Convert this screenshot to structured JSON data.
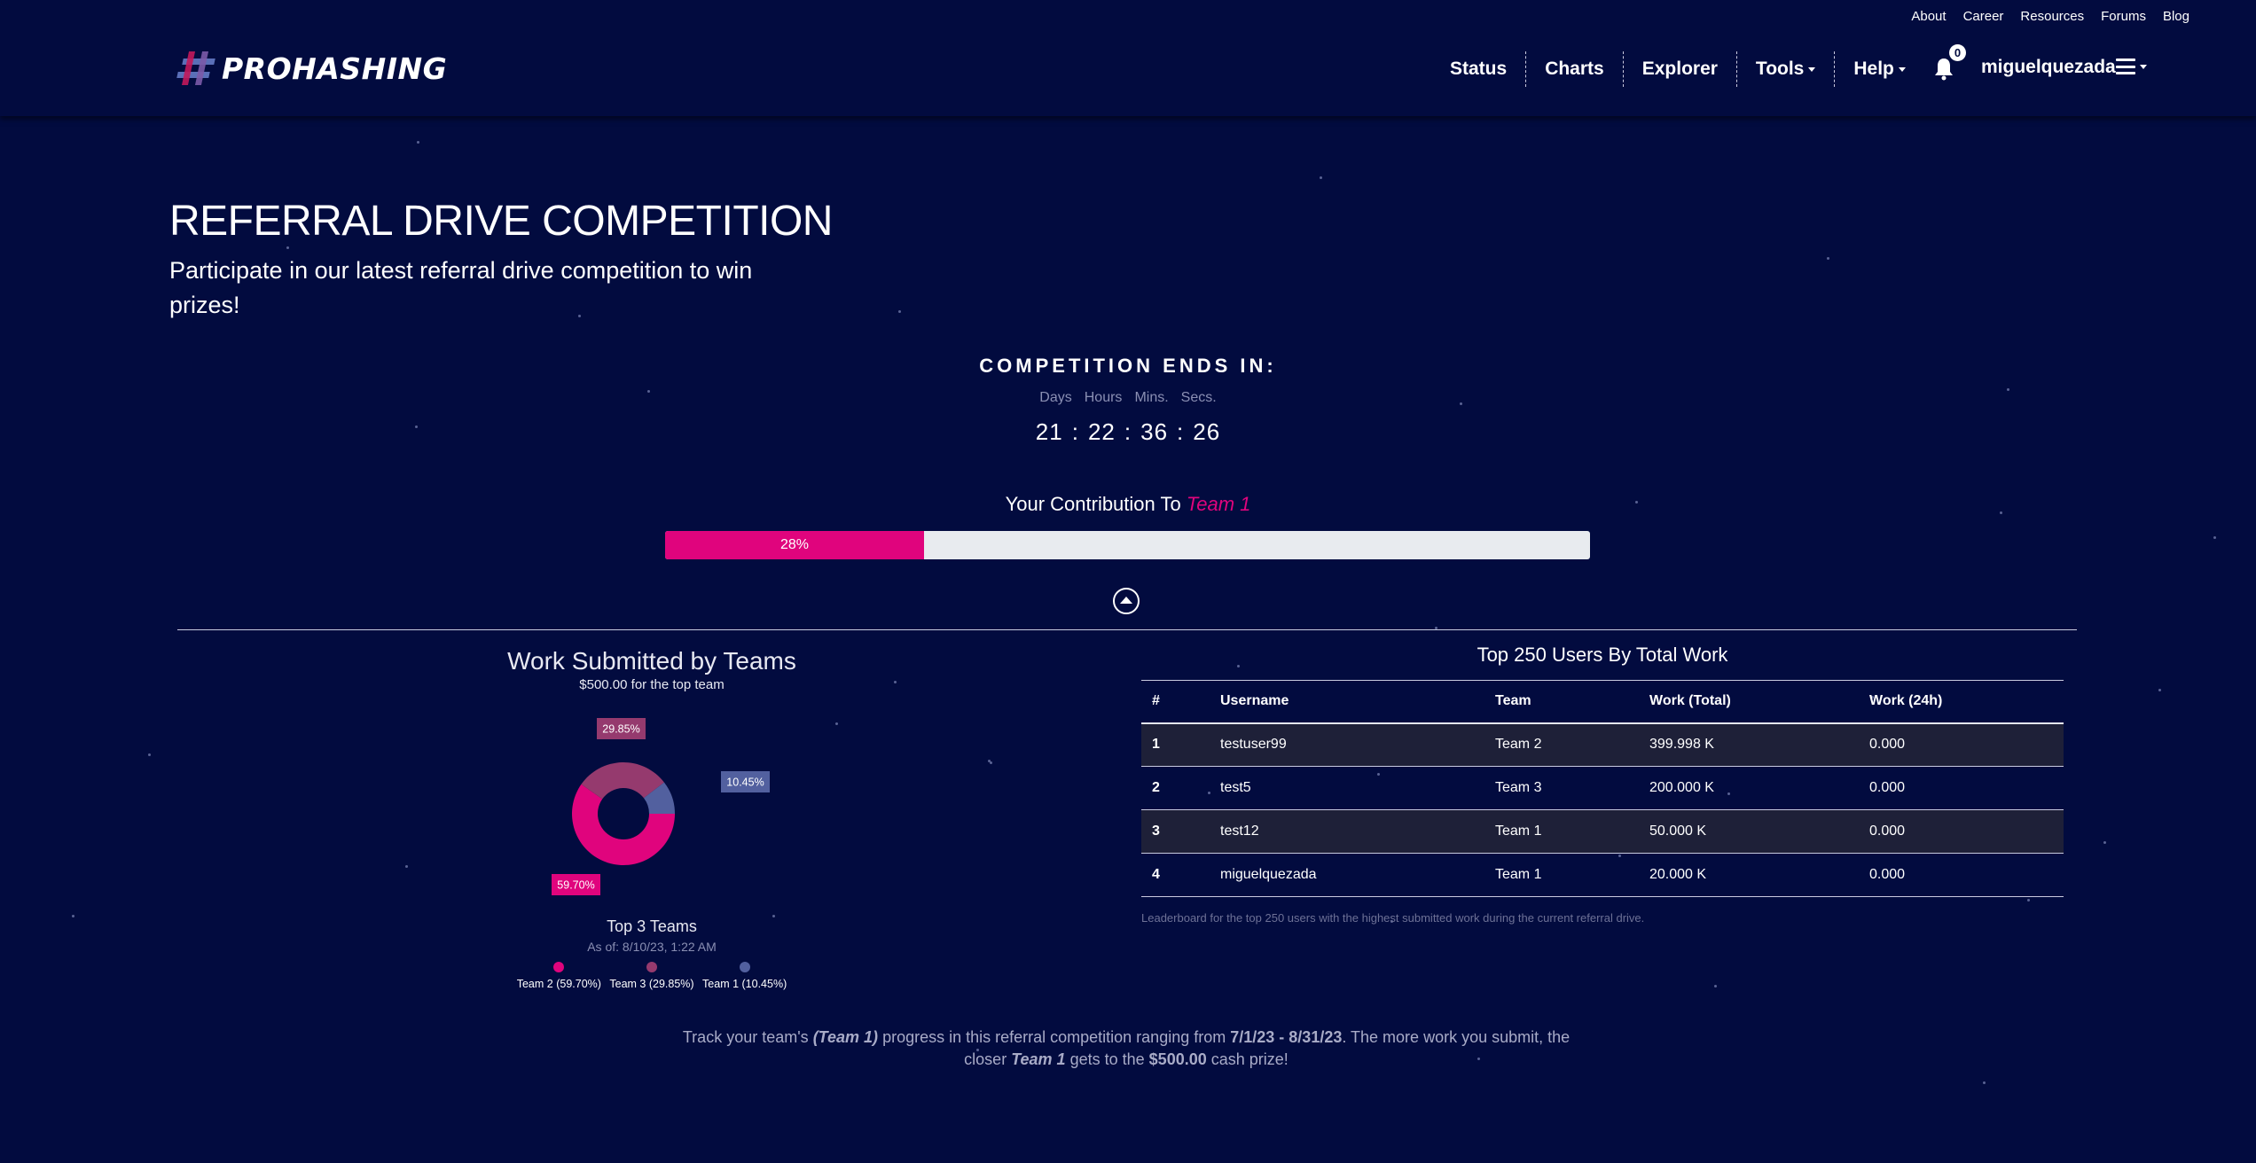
{
  "brand": {
    "name": "PROHASHING",
    "logo_icon": "hash-logo-icon"
  },
  "top_links": [
    "About",
    "Career",
    "Resources",
    "Forums",
    "Blog"
  ],
  "nav": {
    "items": [
      {
        "label": "Status",
        "dropdown": false
      },
      {
        "label": "Charts",
        "dropdown": false
      },
      {
        "label": "Explorer",
        "dropdown": false
      },
      {
        "label": "Tools",
        "dropdown": true
      },
      {
        "label": "Help",
        "dropdown": true
      }
    ],
    "notifications_count": "0",
    "username": "miguelquezada",
    "menu_icon": "hamburger-icon"
  },
  "hero": {
    "title": "REFERRAL DRIVE COMPETITION",
    "subtitle": "Participate in our latest referral drive competition to win prizes!"
  },
  "countdown": {
    "title": "COMPETITION ENDS IN:",
    "labels": [
      "Days",
      "Hours",
      "Mins.",
      "Secs."
    ],
    "values": [
      "21",
      "22",
      "36",
      "26"
    ],
    "separator": ":"
  },
  "contribution": {
    "prefix": "Your Contribution To",
    "team": "Team 1",
    "percent": 28,
    "percent_label": "28%"
  },
  "colors": {
    "accent": "#e0047d",
    "team3": "#953a6e",
    "team1": "#52609f",
    "background": "#020b3f"
  },
  "chart_data": {
    "type": "pie",
    "donut": true,
    "title": "Work Submitted by Teams",
    "subtitle": "$500.00 for the top team",
    "legend_title": "Top 3 Teams",
    "as_of": "As of: 8/10/23, 1:22 AM",
    "legend_position": "bottom",
    "slices": [
      {
        "name": "Team 2",
        "value": 59.7,
        "label": "59.70%",
        "legend": "Team 2 (59.70%)",
        "color": "#e0047d"
      },
      {
        "name": "Team 3",
        "value": 29.85,
        "label": "29.85%",
        "legend": "Team 3 (29.85%)",
        "color": "#953a6e"
      },
      {
        "name": "Team 1",
        "value": 10.45,
        "label": "10.45%",
        "legend": "Team 1 (10.45%)",
        "color": "#52609f"
      }
    ]
  },
  "leaderboard": {
    "title": "Top 250 Users By Total Work",
    "columns": [
      "#",
      "Username",
      "Team",
      "Work (Total)",
      "Work (24h)"
    ],
    "rows": [
      [
        "1",
        "testuser99",
        "Team 2",
        "399.998 K",
        "0.000"
      ],
      [
        "2",
        "test5",
        "Team 3",
        "200.000 K",
        "0.000"
      ],
      [
        "3",
        "test12",
        "Team 1",
        "50.000 K",
        "0.000"
      ],
      [
        "4",
        "miguelquezada",
        "Team 1",
        "20.000 K",
        "0.000"
      ]
    ],
    "caption": "Leaderboard for the top 250 users with the highest submitted work during the current referral drive."
  },
  "footer": {
    "p1": "Track your team's",
    "team_paren": "(Team 1)",
    "p2": "progress in this referral competition ranging from",
    "date_range": "7/1/23 - 8/31/23",
    "p3": ". The more work you submit, the closer",
    "team": "Team 1",
    "p4": "gets to the",
    "prize": "$500.00",
    "p5": "cash prize!"
  }
}
